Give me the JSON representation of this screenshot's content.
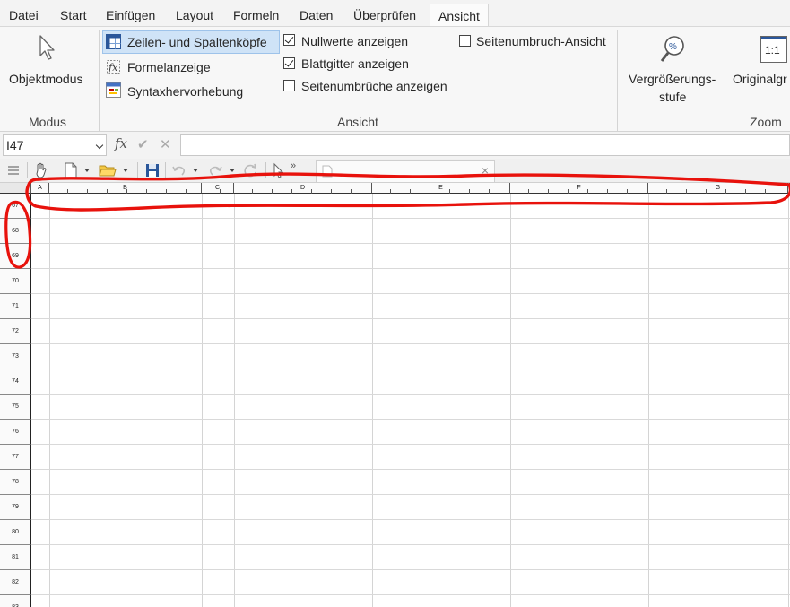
{
  "menu": {
    "tabs": [
      {
        "label": "Datei"
      },
      {
        "label": "Start"
      },
      {
        "label": "Einfügen"
      },
      {
        "label": "Layout"
      },
      {
        "label": "Formeln"
      },
      {
        "label": "Daten"
      },
      {
        "label": "Überprüfen"
      },
      {
        "label": "Ansicht",
        "active": true
      }
    ]
  },
  "ribbon": {
    "modus": {
      "group_label": "Modus",
      "objektmodus_label": "Objektmodus"
    },
    "ansicht": {
      "group_label": "Ansicht",
      "headers_label": "Zeilen- und Spaltenköpfe",
      "headers_selected": true,
      "formula_display_label": "Formelanzeige",
      "syntax_label": "Syntaxhervorhebung",
      "show_zero_label": "Nullwerte anzeigen",
      "show_zero_checked": true,
      "gridlines_label": "Blattgitter anzeigen",
      "gridlines_checked": true,
      "page_breaks_label": "Seitenumbrüche anzeigen",
      "page_breaks_checked": false,
      "page_break_view_label": "Seitenumbruch-Ansicht",
      "page_break_view_checked": false
    },
    "zoom": {
      "group_label": "Zoom",
      "zoom_label_line1": "Vergrößerungs-",
      "zoom_label_line2": "stufe",
      "original_label": "Originalgr",
      "original_icon_text": "1:1"
    }
  },
  "formula_bar": {
    "name_box_value": "I47",
    "fx_label": "fx",
    "confirm_glyph": "✔",
    "cancel_glyph": "✕",
    "formula_value": ""
  },
  "sheet": {
    "columns": [
      "A",
      "B",
      "C",
      "D",
      "E",
      "F",
      "G"
    ],
    "rows": [
      "67",
      "68",
      "69",
      "70",
      "71",
      "72",
      "73",
      "74",
      "75",
      "76",
      "77",
      "78",
      "79",
      "80",
      "81",
      "82",
      "83"
    ]
  },
  "icons": {
    "objektmodus": "cursor-arrow-icon",
    "zeilen_spaltenkoepfe": "table-headers-icon",
    "formelanzeige": "formula-display-icon",
    "syntaxhervorhebung": "syntax-highlight-icon",
    "zoom": "magnifier-percent-icon",
    "original": "one-to-one-icon"
  },
  "colors": {
    "accent": "#217346",
    "annotation": "#e8120c",
    "selected_button": "#cfe3f7"
  }
}
